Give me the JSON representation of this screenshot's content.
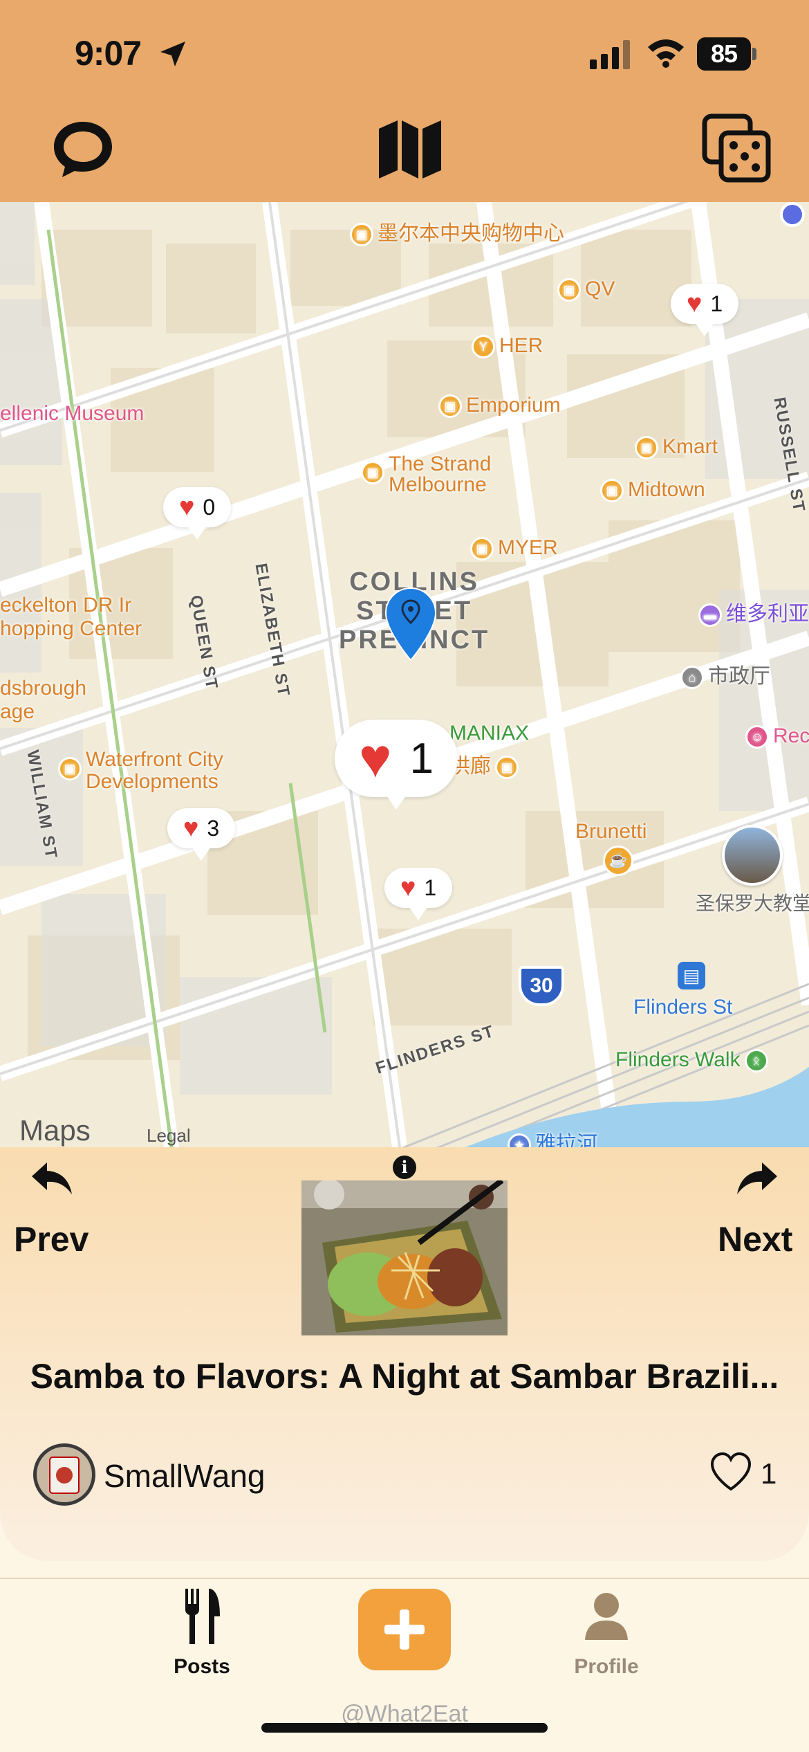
{
  "status_bar": {
    "time": "9:07",
    "battery": "85"
  },
  "map": {
    "pois": [
      {
        "label": "墨尔本中央购物中心"
      },
      {
        "label": "QV"
      },
      {
        "label": "HER"
      },
      {
        "label": "Emporium"
      },
      {
        "label": "Kmart"
      },
      {
        "label": "The Strand\nMelbourne"
      },
      {
        "label": "Midtown"
      },
      {
        "label": "MYER"
      },
      {
        "label": "ellenic Museum"
      },
      {
        "label": "eckelton DR Ir\nhopping Center"
      },
      {
        "label": "dsbrough\nage"
      },
      {
        "label": "维多利亚"
      },
      {
        "label": "市政厅"
      },
      {
        "label": "Rec"
      },
      {
        "label": "MANIAX"
      },
      {
        "label": "拱廊"
      },
      {
        "label": "Waterfront City\nDevelopments"
      },
      {
        "label": "Brunetti"
      },
      {
        "label": "圣保罗大教堂"
      },
      {
        "label": "Flinders St"
      },
      {
        "label": "Flinders Walk"
      },
      {
        "label": "雅拉河"
      }
    ],
    "streets": [
      "ELIZABETH ST",
      "RUSSELL ST",
      "QUEEN ST",
      "WILLIAM ST",
      "FLINDERS ST"
    ],
    "district": "COLLINS\nSTREET\nPRECINCT",
    "route_shield": "30",
    "attribution": {
      "maps": "Maps",
      "legal": "Legal"
    },
    "markers": [
      {
        "likes": "1"
      },
      {
        "likes": "0"
      },
      {
        "likes": "1"
      },
      {
        "likes": "3"
      },
      {
        "likes": "1"
      }
    ]
  },
  "post_card": {
    "prev_label": "Prev",
    "next_label": "Next",
    "title": "Samba to Flavors: A Night at Sambar Brazili...",
    "author": "SmallWang",
    "likes": "1"
  },
  "tab_bar": {
    "posts_label": "Posts",
    "profile_label": "Profile",
    "brand": "@What2Eat"
  },
  "colors": {
    "topbar": "#e8a96a",
    "accent": "#f2a13d",
    "heart": "#e53935",
    "pin": "#1e7ee0"
  }
}
